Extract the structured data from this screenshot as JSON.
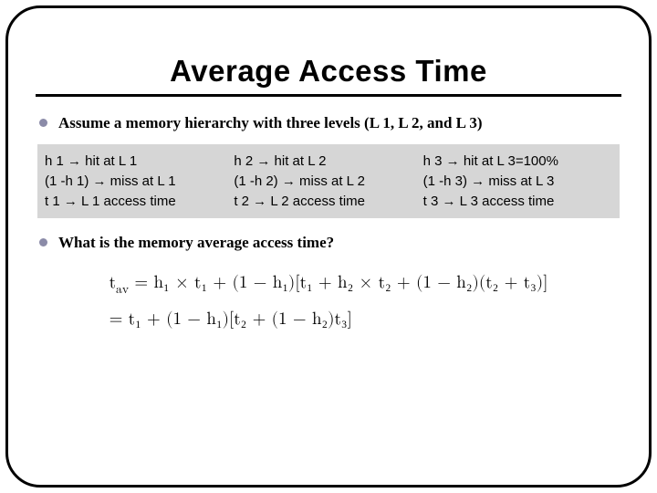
{
  "title": "Average Access Time",
  "bullets": {
    "assume": "Assume a memory hierarchy with three levels (L 1, L 2, and L 3)",
    "question": "What is the memory average access time?"
  },
  "defs": {
    "col1": {
      "l1": "h 1       →  hit at  L 1",
      "l2": "(1 -h 1)  →  miss at L 1",
      "l3": "t 1       →  L 1 access time"
    },
    "col2": {
      "l1": "h 2       →  hit at L 2",
      "l2": "(1 -h 2) →  miss at L 2",
      "l3": "t 2 →  L 2 access time"
    },
    "col3": {
      "l1": "h 3       →  hit at L 3=100%",
      "l2": "(1 -h 3) →  miss at L 3",
      "l3": "t 3 →  L 3 access time"
    }
  },
  "formula": {
    "line1_prefix": "t",
    "line1_sub": "av",
    "line1_rest": " = h₁ × t₁ + (1 − h₁)[t₁ + h₂ × t₂ + (1 − h₂)(t₂ + t₃)]",
    "line2": "   = t₁ + (1 − h₁)[t₂ + (1 − h₂)t₃]"
  }
}
